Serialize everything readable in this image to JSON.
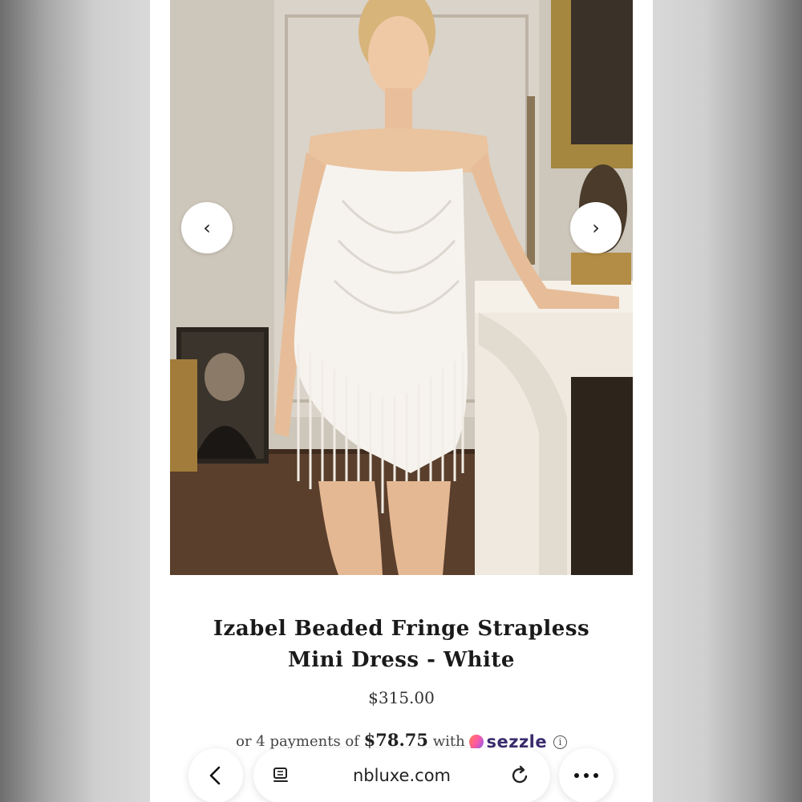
{
  "product": {
    "title": "Izabel Beaded Fringe Strapless Mini Dress - White",
    "price": "$315.00",
    "installments": {
      "prefix": "or 4 payments of",
      "amount": "$78.75",
      "connector": "with",
      "provider": "sezzle",
      "info_glyph": "i"
    }
  },
  "carousel": {
    "prev_icon": "chevron-left-icon",
    "next_icon": "chevron-right-icon",
    "prev_glyph": "‹",
    "next_glyph": "›"
  },
  "browser": {
    "url": "nbluxe.com",
    "back_icon": "chevron-left-icon",
    "tabs_icon": "reader-icon",
    "reload_icon": "reload-icon",
    "more_icon": "more-icon"
  },
  "colors": {
    "sezzle_brand": "#3b2c6e",
    "page_background": "#ffffff"
  }
}
